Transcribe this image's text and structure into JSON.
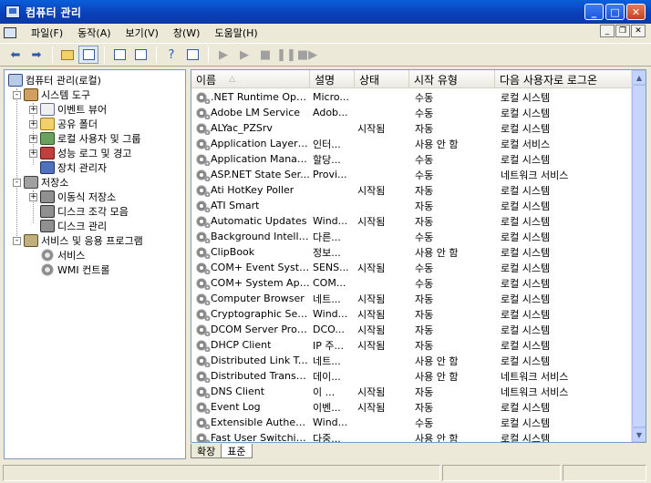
{
  "window": {
    "title": "컴퓨터 관리"
  },
  "menu": [
    "파일(F)",
    "동작(A)",
    "보기(V)",
    "창(W)",
    "도움말(H)"
  ],
  "toolbar": {
    "icons": [
      "back-arrow-icon",
      "forward-arrow-icon",
      "up-folder-icon",
      "show-tree-icon",
      "properties-icon",
      "export-list-icon",
      "help-icon",
      "show-action-pane-icon",
      "play-icon",
      "play-dim-icon",
      "stop-icon",
      "pause-icon",
      "restart-icon"
    ]
  },
  "tree": {
    "root": "컴퓨터 관리(로컬)",
    "items": [
      {
        "label": "시스템 도구",
        "level": 1,
        "exp": "-"
      },
      {
        "label": "이벤트 뷰어",
        "level": 2,
        "exp": "+"
      },
      {
        "label": "공유 폴더",
        "level": 2,
        "exp": "+"
      },
      {
        "label": "로컬 사용자 및 그룹",
        "level": 2,
        "exp": "+"
      },
      {
        "label": "성능 로그 및 경고",
        "level": 2,
        "exp": "+"
      },
      {
        "label": "장치 관리자",
        "level": 2,
        "exp": ""
      },
      {
        "label": "저장소",
        "level": 1,
        "exp": "-"
      },
      {
        "label": "이동식 저장소",
        "level": 2,
        "exp": "+"
      },
      {
        "label": "디스크 조각 모음",
        "level": 2,
        "exp": ""
      },
      {
        "label": "디스크 관리",
        "level": 2,
        "exp": ""
      },
      {
        "label": "서비스 및 응용 프로그램",
        "level": 1,
        "exp": "-"
      },
      {
        "label": "서비스",
        "level": 2,
        "exp": ""
      },
      {
        "label": "WMI 컨트롤",
        "level": 2,
        "exp": ""
      }
    ]
  },
  "list": {
    "columns": [
      "이름",
      "설명",
      "상태",
      "시작 유형",
      "다음 사용자로 로그온"
    ],
    "sort_indicator": "△",
    "rows": [
      [
        ".NET Runtime Opti...",
        "Micro...",
        "",
        "수동",
        "로컬 시스템"
      ],
      [
        "Adobe LM Service",
        "Adob...",
        "",
        "수동",
        "로컬 시스템"
      ],
      [
        "ALYac_PZSrv",
        "",
        "시작됨",
        "자동",
        "로컬 시스템"
      ],
      [
        "Application Layer G...",
        "인터...",
        "",
        "사용 안 함",
        "로컬 서비스"
      ],
      [
        "Application Manage...",
        "할당...",
        "",
        "수동",
        "로컬 시스템"
      ],
      [
        "ASP.NET State Ser...",
        "Provi...",
        "",
        "수동",
        "네트워크 서비스"
      ],
      [
        "Ati HotKey Poller",
        "",
        "시작됨",
        "자동",
        "로컬 시스템"
      ],
      [
        "ATI Smart",
        "",
        "",
        "자동",
        "로컬 시스템"
      ],
      [
        "Automatic Updates",
        "Wind...",
        "시작됨",
        "자동",
        "로컬 시스템"
      ],
      [
        "Background Intellig...",
        "다른...",
        "",
        "수동",
        "로컬 시스템"
      ],
      [
        "ClipBook",
        "정보...",
        "",
        "사용 안 함",
        "로컬 시스템"
      ],
      [
        "COM+ Event System",
        "SENS...",
        "시작됨",
        "수동",
        "로컬 시스템"
      ],
      [
        "COM+ System Appl...",
        "COM...",
        "",
        "수동",
        "로컬 시스템"
      ],
      [
        "Computer Browser",
        "네트...",
        "시작됨",
        "자동",
        "로컬 시스템"
      ],
      [
        "Cryptographic Serv...",
        "Wind...",
        "시작됨",
        "자동",
        "로컬 시스템"
      ],
      [
        "DCOM Server Proc...",
        "DCO...",
        "시작됨",
        "자동",
        "로컬 시스템"
      ],
      [
        "DHCP Client",
        "IP 주...",
        "시작됨",
        "자동",
        "로컬 시스템"
      ],
      [
        "Distributed Link Tra...",
        "네트...",
        "",
        "사용 안 함",
        "로컬 시스템"
      ],
      [
        "Distributed Transac...",
        "데이...",
        "",
        "사용 안 함",
        "네트워크 서비스"
      ],
      [
        "DNS Client",
        "이 ...",
        "시작됨",
        "자동",
        "네트워크 서비스"
      ],
      [
        "Event Log",
        "이벤...",
        "시작됨",
        "자동",
        "로컬 시스템"
      ],
      [
        "Extensible Authenti...",
        "Wind...",
        "",
        "수동",
        "로컬 시스템"
      ],
      [
        "Fast User Switching...",
        "다중...",
        "",
        "사용 안 함",
        "로컬 시스템"
      ]
    ]
  },
  "tabs": [
    "확장",
    "표준"
  ]
}
